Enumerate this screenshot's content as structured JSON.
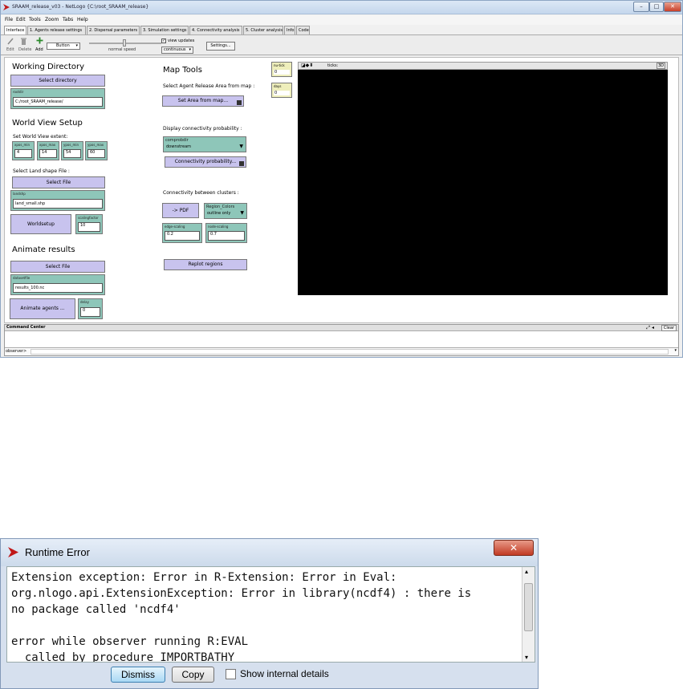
{
  "window": {
    "title": "SRAAM_release_v03 - NetLogo {C:\\root_SRAAM_release}",
    "buttons": {
      "minimize": "–",
      "maximize": "□",
      "close": "✕"
    }
  },
  "menu": [
    "File",
    "Edit",
    "Tools",
    "Zoom",
    "Tabs",
    "Help"
  ],
  "tabs": [
    "Interface",
    "1. Agents release settings",
    "2. Dispersal parameters",
    "3. Simulation settings",
    "4. Connectivity analysis",
    "5. Cluster analysis",
    "Info",
    "Code"
  ],
  "toolbar": {
    "edit": "Edit",
    "delete": "Delete",
    "add": "Add",
    "widget_type": "Button",
    "speed_label": "normal speed",
    "view_updates": "view updates",
    "update_mode": "continuous",
    "settings": "Settings..."
  },
  "interface": {
    "working_directory_header": "Working Directory",
    "select_directory": "Select directory",
    "rootdir_label": "rootdir",
    "rootdir_value": "C:/root_SRAAM_release/",
    "world_view_header": "World View Setup",
    "set_world_extent": "Set World View extent:",
    "xpos_min_label": "xpos_min",
    "xpos_min_value": "4",
    "xpos_max_label": "xpos_max",
    "xpos_max_value": "14",
    "ypos_min_label": "ypos_min",
    "ypos_min_value": "54",
    "ypos_max_label": "ypos_max",
    "ypos_max_value": "60",
    "select_land_file": "Select Land shape File :",
    "select_file_1": "Select File",
    "landshp_label": "landshp",
    "landshp_value": "land_small.shp",
    "worldsetup": "Worldsetup",
    "scalingfactor_label": "scalingfactor",
    "scalingfactor_value": "10",
    "animate_header": "Animate results",
    "select_file_2": "Select File",
    "datasetfile_label": "datasetfile",
    "datasetfile_value": "results_100.nc",
    "animate_agents": "Animate agents ...",
    "delay_label": "delay",
    "delay_value": "0",
    "map_tools_header": "Map Tools",
    "select_release_area": "Select Agent Release Area from map :",
    "set_area_from_map": "Set Area from map...",
    "display_connectivity": "Display connectivity probability :",
    "comprobdir_label": "comprobdir",
    "comprobdir_value": "downstream",
    "connectivity_probability": "Connectivity probability...",
    "connectivity_between": "Connectivity between clusters :",
    "to_pdf": "-> PDF",
    "region_colors_label": "Region_Colors",
    "region_colors_value": "outline only",
    "edge_scaling_label": "edge-scaling",
    "edge_scaling_value": "0.2",
    "node_scaling_label": "node-scaling",
    "node_scaling_value": "0.7",
    "replot_regions": "Replot regions",
    "monitor1_label": "nu-tick",
    "monitor1_value": "0",
    "monitor2_label": "days",
    "monitor2_value": "0",
    "ticks_label": "ticks:"
  },
  "command_center": {
    "title": "Command Center",
    "clear": "Clear",
    "prompt": "observer>"
  },
  "dialog": {
    "title": "Runtime Error",
    "lines": [
      "Extension exception: Error in R-Extension: Error in Eval:",
      "org.nlogo.api.ExtensionException: Error in library(ncdf4) : there is",
      "no package called 'ncdf4'",
      "",
      "error while observer running R:EVAL",
      "  called by procedure IMPORTBATHY"
    ],
    "dismiss": "Dismiss",
    "copy": "Copy",
    "show_internal": "Show internal details"
  },
  "colors": {
    "button": "#c8c3ee",
    "input": "#8ec6b9",
    "monitor": "#eeeebb",
    "view": "#000000",
    "error_accent": "#c01818"
  }
}
